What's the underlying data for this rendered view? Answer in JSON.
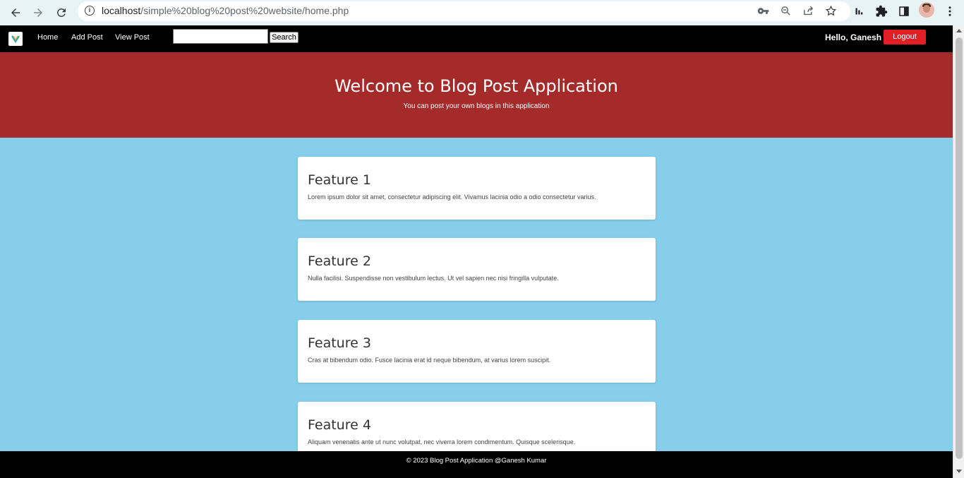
{
  "browser": {
    "url_host": "localhost",
    "url_path": "/simple%20blog%20post%20website/home.php",
    "icons": {
      "back": "arrow-left-icon",
      "forward": "arrow-right-icon",
      "reload": "reload-icon",
      "site_info": "info-icon",
      "password": "key-icon",
      "zoom": "zoom-out-icon",
      "share": "share-icon",
      "bookmark": "star-icon",
      "extensions": [
        "puzzle-icon",
        "side-panel-icon",
        "kebab-menu-icon"
      ]
    }
  },
  "nav": {
    "logo": "site-logo-icon",
    "links": [
      "Home",
      "Add Post",
      "View Post"
    ],
    "search": {
      "value": "",
      "placeholder": "",
      "button": "Search"
    },
    "greeting": "Hello, Ganesh",
    "logout": "Logout"
  },
  "hero": {
    "title": "Welcome to Blog Post Application",
    "subtitle": "You can post your own blogs in this application"
  },
  "features": [
    {
      "title": "Feature 1",
      "text": "Lorem ipsum dolor sit amet, consectetur adipiscing elit. Vivamus lacinia odio a odio consectetur varius."
    },
    {
      "title": "Feature 2",
      "text": "Nulla facilisi. Suspendisse non vestibulum lectus. Ut vel sapien nec nisi fringilla vulputate."
    },
    {
      "title": "Feature 3",
      "text": "Cras at bibendum odio. Fusce lacinia erat id neque bibendum, at varius lorem suscipit."
    },
    {
      "title": "Feature 4",
      "text": "Aliquam venenatis ante ut nunc volutpat, nec viverra lorem condimentum. Quisque scelerisque."
    }
  ],
  "footer": {
    "text": "© 2023 Blog Post Application @Ganesh Kumar"
  },
  "colors": {
    "nav_bg": "#000000",
    "hero_bg": "#a52a2a",
    "page_bg": "#87ceeb",
    "logout_bg": "#e31e24",
    "card_bg": "#ffffff"
  }
}
